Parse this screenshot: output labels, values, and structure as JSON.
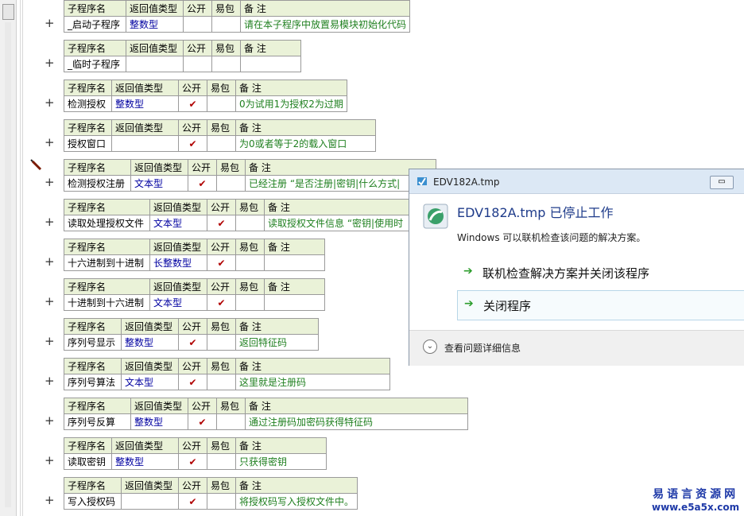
{
  "header_labels": {
    "name": "子程序名",
    "rtype": "返回值类型",
    "pub": "公开",
    "epkg": "易包",
    "note": "备 注"
  },
  "check_mark": "✔",
  "plus_mark": "+",
  "blocks": [
    {
      "name": "_启动子程序",
      "rtype": "整数型",
      "pub": "",
      "note": "请在本子程序中放置易模块初始化代码"
    },
    {
      "name": "_临时子程序",
      "rtype": "",
      "pub": "",
      "note": ""
    },
    {
      "name": "检测授权",
      "rtype": "整数型",
      "pub": "✔",
      "note": "0为试用1为授权2为过期"
    },
    {
      "name": "授权窗口",
      "rtype": "",
      "pub": "✔",
      "note": "为0或者等于2的载入窗口"
    },
    {
      "name": "检测授权注册",
      "rtype": "文本型",
      "pub": "✔",
      "note": "已经注册 “是否注册|密钥|什么方式|"
    },
    {
      "name": "读取处理授权文件",
      "rtype": "文本型",
      "pub": "✔",
      "note": "读取授权文件信息 “密钥|使用时"
    },
    {
      "name": "十六进制到十进制",
      "rtype": "长整数型",
      "pub": "✔",
      "note": ""
    },
    {
      "name": "十进制到十六进制",
      "rtype": "文本型",
      "pub": "✔",
      "note": ""
    },
    {
      "name": "序列号显示",
      "rtype": "整数型",
      "pub": "✔",
      "note": "返回特征码"
    },
    {
      "name": "序列号算法",
      "rtype": "文本型",
      "pub": "✔",
      "note": "这里就是注册码"
    },
    {
      "name": "序列号反算",
      "rtype": "整数型",
      "pub": "✔",
      "note": "通过注册码加密码获得特征码"
    },
    {
      "name": "读取密钥",
      "rtype": "整数型",
      "pub": "✔",
      "note": "只获得密钥"
    },
    {
      "name": "写入授权码",
      "rtype": "",
      "pub": "✔",
      "note": "将授权码写入授权文件中。"
    }
  ],
  "dialog": {
    "title": "EDV182A.tmp",
    "heading": "EDV182A.tmp 已停止工作",
    "subtext": "Windows 可以联机检查该问题的解决方案。",
    "option1": "联机检查解决方案并关闭该程序",
    "option2": "关闭程序",
    "details": "查看问题详细信息",
    "arrow": "➔",
    "chevron": "⌄",
    "minimize": "▭"
  },
  "watermark": {
    "line1": "易语言资源网",
    "line2": "www.e5a5x.com"
  }
}
